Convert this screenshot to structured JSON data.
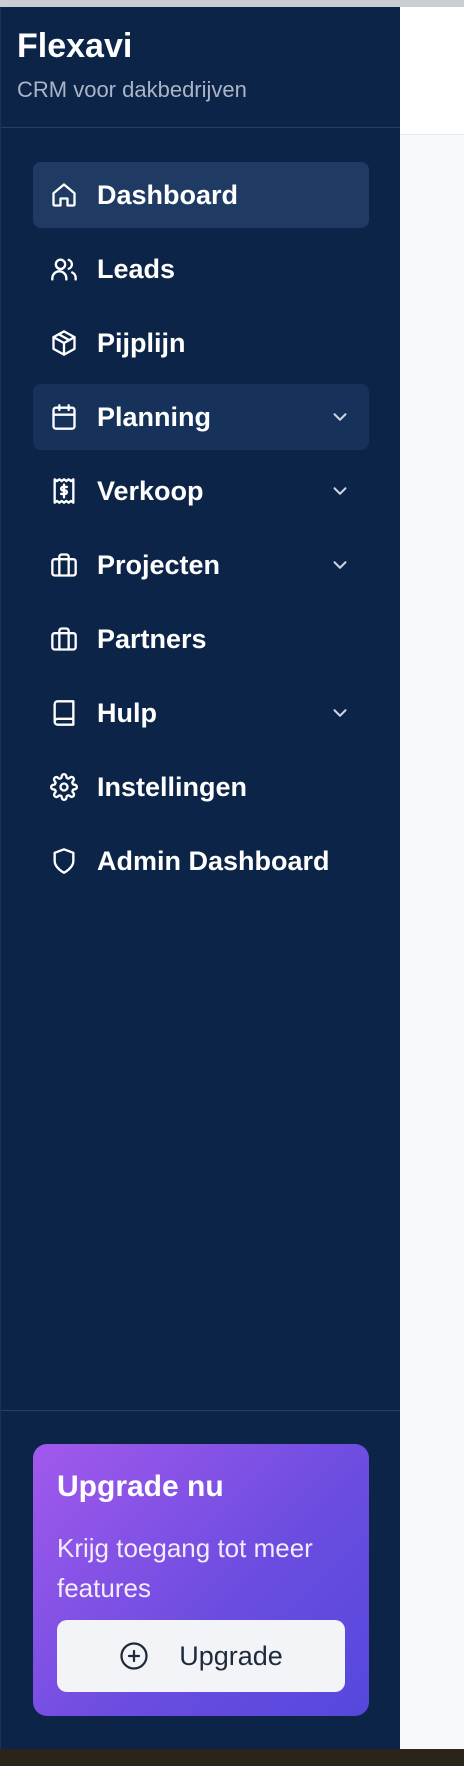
{
  "brand": {
    "title": "Flexavi",
    "subtitle": "CRM voor dakbedrijven"
  },
  "nav": [
    {
      "label": "Dashboard",
      "icon": "home-icon",
      "state": "active",
      "has_submenu": false
    },
    {
      "label": "Leads",
      "icon": "users-icon",
      "state": "normal",
      "has_submenu": false
    },
    {
      "label": "Pijplijn",
      "icon": "package-icon",
      "state": "normal",
      "has_submenu": false
    },
    {
      "label": "Planning",
      "icon": "calendar-icon",
      "state": "hover",
      "has_submenu": true
    },
    {
      "label": "Verkoop",
      "icon": "receipt-icon",
      "state": "normal",
      "has_submenu": true
    },
    {
      "label": "Projecten",
      "icon": "briefcase-icon",
      "state": "normal",
      "has_submenu": true
    },
    {
      "label": "Partners",
      "icon": "briefcase-icon",
      "state": "normal",
      "has_submenu": false
    },
    {
      "label": "Hulp",
      "icon": "book-icon",
      "state": "normal",
      "has_submenu": true
    },
    {
      "label": "Instellingen",
      "icon": "gear-icon",
      "state": "normal",
      "has_submenu": false
    },
    {
      "label": "Admin Dashboard",
      "icon": "shield-icon",
      "state": "normal",
      "has_submenu": false
    }
  ],
  "upgrade": {
    "title": "Upgrade nu",
    "text": "Krijg toegang tot meer features",
    "button_label": "Upgrade",
    "button_icon": "plus-circle-icon"
  },
  "colors": {
    "sidebar_bg": "#0c2447",
    "active_bg": "#1f3b63",
    "card_gradient_start": "#a259ec",
    "card_gradient_end": "#5548dc"
  }
}
